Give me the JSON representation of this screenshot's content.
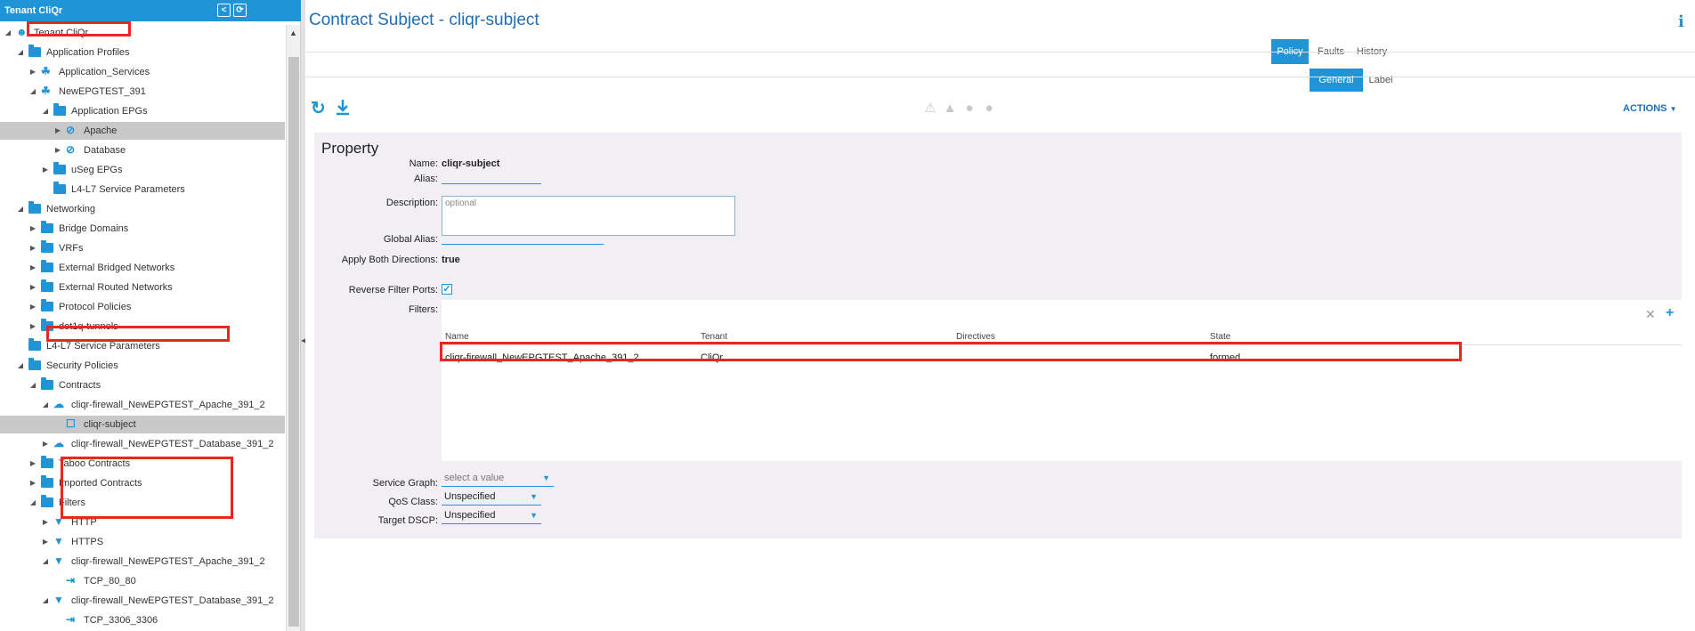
{
  "left_panel": {
    "header_title": "Tenant CliQr",
    "tree": [
      {
        "label": "Tenant CliQr",
        "depth": 0,
        "icon": "tenant-icon",
        "expanded": true,
        "redbox": true
      },
      {
        "label": "Application Profiles",
        "depth": 1,
        "icon": "folder-icon",
        "expanded": true
      },
      {
        "label": "Application_Services",
        "depth": 2,
        "icon": "app-profile-icon",
        "expanded": false
      },
      {
        "label": "NewEPGTEST_391",
        "depth": 2,
        "icon": "app-profile-icon",
        "expanded": true
      },
      {
        "label": "Application EPGs",
        "depth": 3,
        "icon": "folder-icon",
        "expanded": true
      },
      {
        "label": "Apache",
        "depth": 4,
        "icon": "epg-icon",
        "expanded": false,
        "selected": true
      },
      {
        "label": "Database",
        "depth": 4,
        "icon": "epg-icon",
        "expanded": false
      },
      {
        "label": "uSeg EPGs",
        "depth": 3,
        "icon": "folder-icon",
        "expanded": false
      },
      {
        "label": "L4-L7 Service Parameters",
        "depth": 3,
        "icon": "folder-icon",
        "leaf": true
      },
      {
        "label": "Networking",
        "depth": 1,
        "icon": "folder-icon",
        "expanded": true
      },
      {
        "label": "Bridge Domains",
        "depth": 2,
        "icon": "folder-icon",
        "expanded": false
      },
      {
        "label": "VRFs",
        "depth": 2,
        "icon": "folder-icon",
        "expanded": false
      },
      {
        "label": "External Bridged Networks",
        "depth": 2,
        "icon": "folder-icon",
        "expanded": false
      },
      {
        "label": "External Routed Networks",
        "depth": 2,
        "icon": "folder-icon",
        "expanded": false
      },
      {
        "label": "Protocol Policies",
        "depth": 2,
        "icon": "folder-icon",
        "expanded": false
      },
      {
        "label": "dot1q-tunnels",
        "depth": 2,
        "icon": "folder-icon",
        "expanded": false
      },
      {
        "label": "L4-L7 Service Parameters",
        "depth": 1,
        "icon": "folder-icon",
        "leaf": true
      },
      {
        "label": "Security Policies",
        "depth": 1,
        "icon": "folder-icon",
        "expanded": true
      },
      {
        "label": "Contracts",
        "depth": 2,
        "icon": "folder-icon",
        "expanded": true
      },
      {
        "label": "cliqr-firewall_NewEPGTEST_Apache_391_2",
        "depth": 3,
        "icon": "contract-icon",
        "expanded": true,
        "redbox": true
      },
      {
        "label": "cliqr-subject",
        "depth": 4,
        "icon": "subject-icon",
        "leaf": true,
        "selected": true
      },
      {
        "label": "cliqr-firewall_NewEPGTEST_Database_391_2",
        "depth": 3,
        "icon": "contract-icon",
        "expanded": false
      },
      {
        "label": "Taboo Contracts",
        "depth": 2,
        "icon": "folder-icon",
        "expanded": false
      },
      {
        "label": "Imported Contracts",
        "depth": 2,
        "icon": "folder-icon",
        "expanded": false
      },
      {
        "label": "Filters",
        "depth": 2,
        "icon": "folder-icon",
        "expanded": true
      },
      {
        "label": "HTTP",
        "depth": 3,
        "icon": "filter-icon",
        "expanded": false
      },
      {
        "label": "HTTPS",
        "depth": 3,
        "icon": "filter-icon",
        "expanded": false
      },
      {
        "label": "cliqr-firewall_NewEPGTEST_Apache_391_2",
        "depth": 3,
        "icon": "filter-icon",
        "expanded": true
      },
      {
        "label": "TCP_80_80",
        "depth": 4,
        "icon": "filter-entry-icon",
        "leaf": true
      },
      {
        "label": "cliqr-firewall_NewEPGTEST_Database_391_2",
        "depth": 3,
        "icon": "filter-icon",
        "expanded": true
      },
      {
        "label": "TCP_3306_3306",
        "depth": 4,
        "icon": "filter-entry-icon",
        "leaf": true
      }
    ]
  },
  "main": {
    "title": "Contract Subject - cliqr-subject",
    "top_tabs": [
      "Policy",
      "Faults",
      "History"
    ],
    "active_top_tab": "Policy",
    "sub_tabs": [
      "General",
      "Label"
    ],
    "active_sub_tab": "General",
    "actions_label": "ACTIONS",
    "property": {
      "section_title": "Property",
      "name_label": "Name:",
      "name_value": "cliqr-subject",
      "alias_label": "Alias:",
      "alias_value": "",
      "description_label": "Description:",
      "description_placeholder": "optional",
      "global_alias_label": "Global Alias:",
      "global_alias_value": "",
      "apply_both_label": "Apply Both Directions:",
      "apply_both_value": "true",
      "reverse_filter_label": "Reverse Filter Ports:",
      "reverse_filter_checked": true,
      "filters_label": "Filters:",
      "filters_table": {
        "columns": [
          "Name",
          "Tenant",
          "Directives",
          "State"
        ],
        "rows": [
          [
            "cliqr-firewall_NewEPGTEST_Apache_391_2",
            "CliQr",
            "",
            "formed"
          ]
        ]
      },
      "service_graph_label": "Service Graph:",
      "service_graph_value": "select a value",
      "qos_label": "QoS Class:",
      "qos_value": "Unspecified",
      "dscp_label": "Target DSCP:",
      "dscp_value": "Unspecified"
    }
  },
  "colors": {
    "accent": "#1f94d6",
    "title": "#1f6fb4",
    "highlight_box": "#e8281e",
    "selected_row": "#c8c8c8"
  }
}
